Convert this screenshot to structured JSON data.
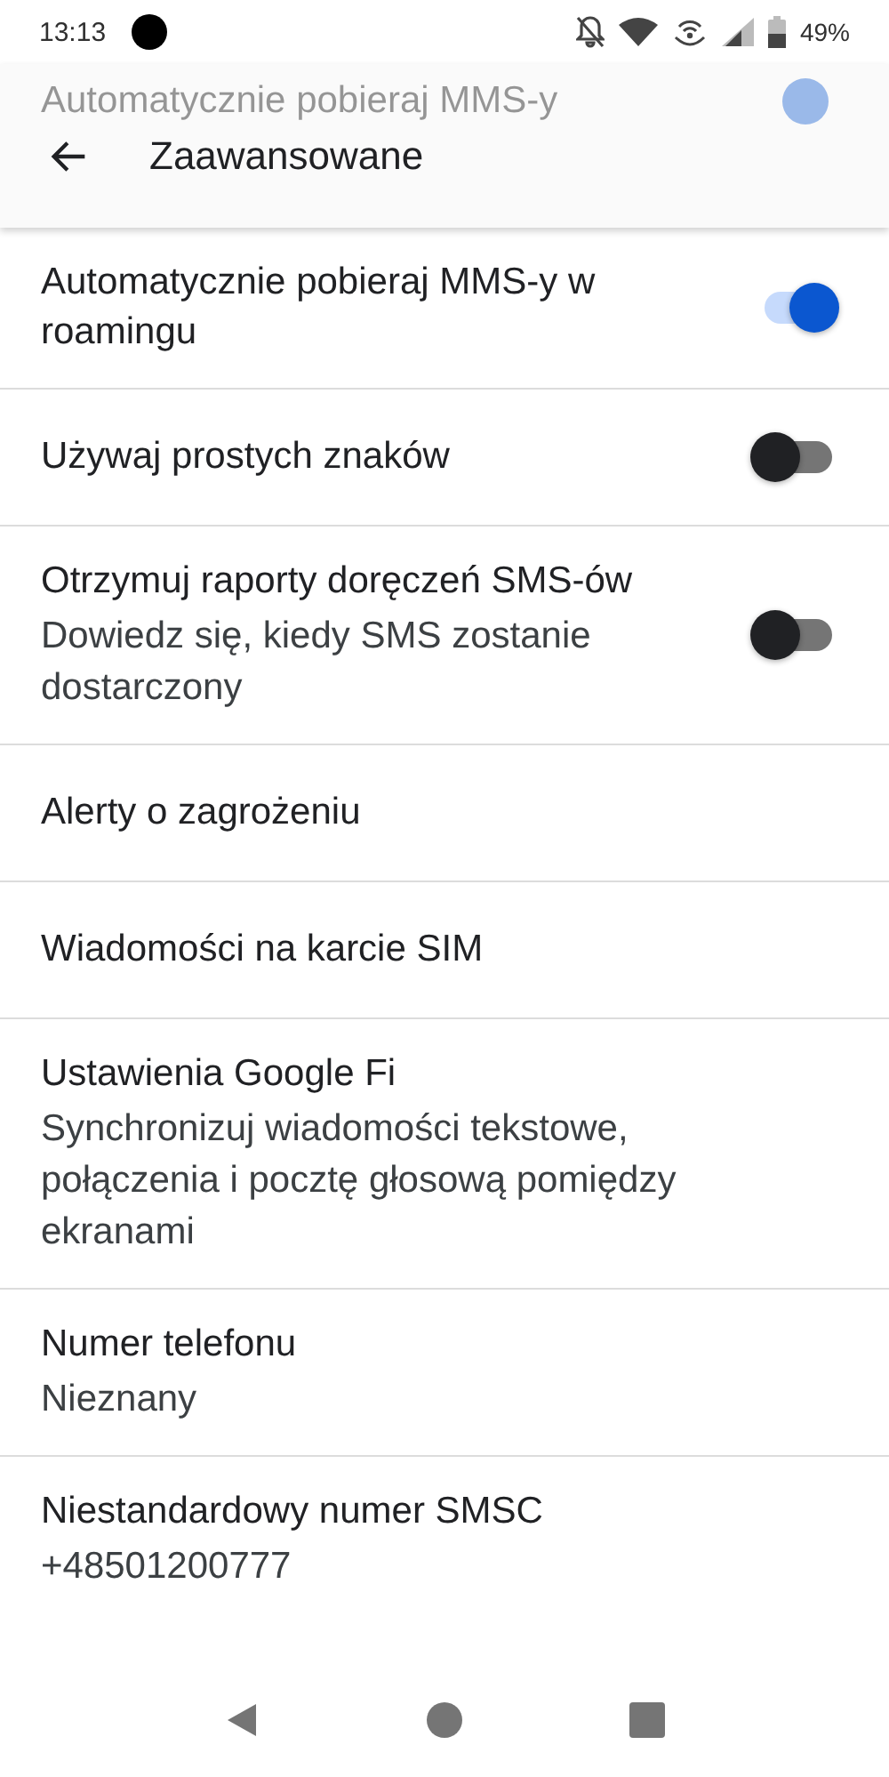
{
  "status_bar": {
    "time": "13:13",
    "battery": "49%"
  },
  "app_bar": {
    "title": "Zaawansowane",
    "scrolled_item": {
      "title": "Automatycznie pobieraj MMS-y",
      "on": true
    }
  },
  "settings": [
    {
      "kind": "toggle",
      "title": "Automatycznie pobieraj MMS-y w roamingu",
      "on": true
    },
    {
      "kind": "toggle",
      "title": "Używaj prostych znaków",
      "on": false
    },
    {
      "kind": "toggle",
      "title": "Otrzymuj raporty doręczeń SMS-ów",
      "subtitle": "Dowiedz się, kiedy SMS zostanie dostarczony",
      "on": false
    },
    {
      "kind": "plain",
      "title": "Alerty o zagrożeniu"
    },
    {
      "kind": "plain",
      "title": "Wiadomości na karcie SIM"
    },
    {
      "kind": "plain",
      "title": "Ustawienia Google Fi",
      "subtitle": "Synchronizuj wiadomości tekstowe, połączenia i pocztę głosową pomiędzy ekranami"
    },
    {
      "kind": "plain",
      "title": "Numer telefonu",
      "subtitle": "Nieznany"
    },
    {
      "kind": "plain",
      "title": "Niestandardowy numer SMSC",
      "subtitle": "+48501200777"
    }
  ]
}
